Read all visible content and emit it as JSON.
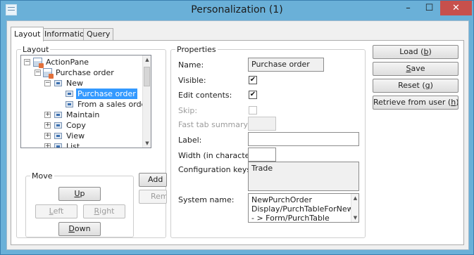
{
  "window": {
    "title": "Personalization (1)",
    "controls": {
      "minimize": "–",
      "maximize": "☐",
      "close": "✕"
    }
  },
  "tabs": [
    {
      "label": "Layout",
      "active": true
    },
    {
      "label": "Information",
      "active": false
    },
    {
      "label": "Query",
      "active": false
    }
  ],
  "layout_group": {
    "legend": "Layout",
    "tree": [
      {
        "label": "ActionPane",
        "expander": "−",
        "icon": "action-pane-icon"
      },
      {
        "label": "Purchase order",
        "expander": "−",
        "icon": "action-pane-tab-icon"
      },
      {
        "label": "New",
        "expander": "−",
        "icon": "button-group-icon"
      },
      {
        "label": "Purchase order",
        "expander": "",
        "icon": "menu-item-icon",
        "selected": true
      },
      {
        "label": "From a sales order",
        "expander": "",
        "icon": "menu-item-icon"
      },
      {
        "label": "Maintain",
        "expander": "+",
        "icon": "button-group-icon"
      },
      {
        "label": "Copy",
        "expander": "+",
        "icon": "button-group-icon"
      },
      {
        "label": "View",
        "expander": "+",
        "icon": "button-group-icon"
      },
      {
        "label": "List",
        "expander": "+",
        "icon": "button-group-icon"
      }
    ],
    "move": {
      "legend": "Move",
      "up": "Up",
      "up_key": "U",
      "left": "Left",
      "left_key": "L",
      "right": "Right",
      "right_key": "R",
      "down": "Down",
      "down_key": "D"
    },
    "add_button": "Add",
    "remove_button": "Rem"
  },
  "properties": {
    "legend": "Properties",
    "name_label": "Name:",
    "name_value": "Purchase order",
    "visible_label": "Visible:",
    "visible_checked": true,
    "edit_label": "Edit contents:",
    "edit_checked": true,
    "skip_label": "Skip:",
    "skip_checked": false,
    "fasttab_label": "Fast tab summary:",
    "fasttab_value": "",
    "label_label": "Label:",
    "label_value": "",
    "width_label": "Width (in characters):",
    "width_value": "",
    "config_label": "Configuration keys:",
    "config_value": "Trade",
    "system_label": "System name:",
    "system_lines": [
      "NewPurchOrder",
      "Display/PurchTableForNew_Action",
      " - > Form/PurchTable"
    ]
  },
  "actions": {
    "load": "Load (b)",
    "load_pre": "Load (",
    "load_key": "b",
    "load_post": ")",
    "save": "Save",
    "save_key": "S",
    "save_rest": "ave",
    "reset": "Reset (g)",
    "reset_pre": "Reset (",
    "reset_key": "g",
    "reset_post": ")",
    "retrieve": "Retrieve from user (h)",
    "retrieve_pre": "Retrieve from user (",
    "retrieve_key": "h",
    "retrieve_post": ")"
  }
}
